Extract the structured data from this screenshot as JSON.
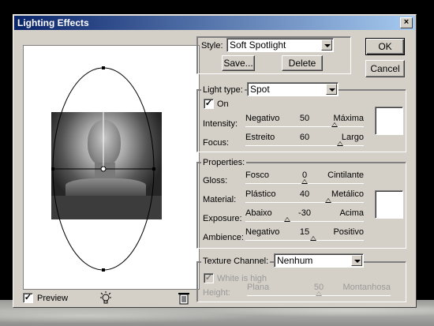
{
  "window": {
    "title": "Lighting Effects"
  },
  "preview": {
    "preview_label": "Preview",
    "preview_checked": true
  },
  "style": {
    "label": "Style:",
    "value": "Soft Spotlight",
    "save_label": "Save...",
    "delete_label": "Delete"
  },
  "buttons": {
    "ok": "OK",
    "cancel": "Cancel"
  },
  "light_type": {
    "label": "Light type:",
    "value": "Spot",
    "on_label": "On",
    "on_checked": true,
    "intensity": {
      "label": "Intensity:",
      "min": "Negativo",
      "max": "Máxima",
      "value": "50",
      "fraction": 0.75
    },
    "focus": {
      "label": "Focus:",
      "min": "Estreito",
      "max": "Largo",
      "value": "60",
      "fraction": 0.8
    },
    "color": "#ffffff"
  },
  "properties": {
    "label": "Properties:",
    "gloss": {
      "label": "Gloss:",
      "min": "Fosco",
      "max": "Cintilante",
      "value": "0",
      "fraction": 0.5
    },
    "material": {
      "label": "Material:",
      "min": "Plástico",
      "max": "Metálico",
      "value": "40",
      "fraction": 0.7
    },
    "exposure": {
      "label": "Exposure:",
      "min": "Abaixo",
      "max": "Acima",
      "value": "-30",
      "fraction": 0.35
    },
    "ambience": {
      "label": "Ambience:",
      "min": "Negativo",
      "max": "Positivo",
      "value": "15",
      "fraction": 0.575
    },
    "color": "#ffffff"
  },
  "texture": {
    "label": "Texture Channel:",
    "value": "Nenhum",
    "white_is_high_label": "White is high",
    "white_is_high_checked": true,
    "height": {
      "label": "Height:",
      "min": "Plana",
      "max": "Montanhosa",
      "value": "50",
      "fraction": 0.5
    }
  },
  "icons": {
    "close": "close-icon",
    "bulb": "light-bulb-icon",
    "trash": "trash-icon",
    "check": "✓"
  }
}
